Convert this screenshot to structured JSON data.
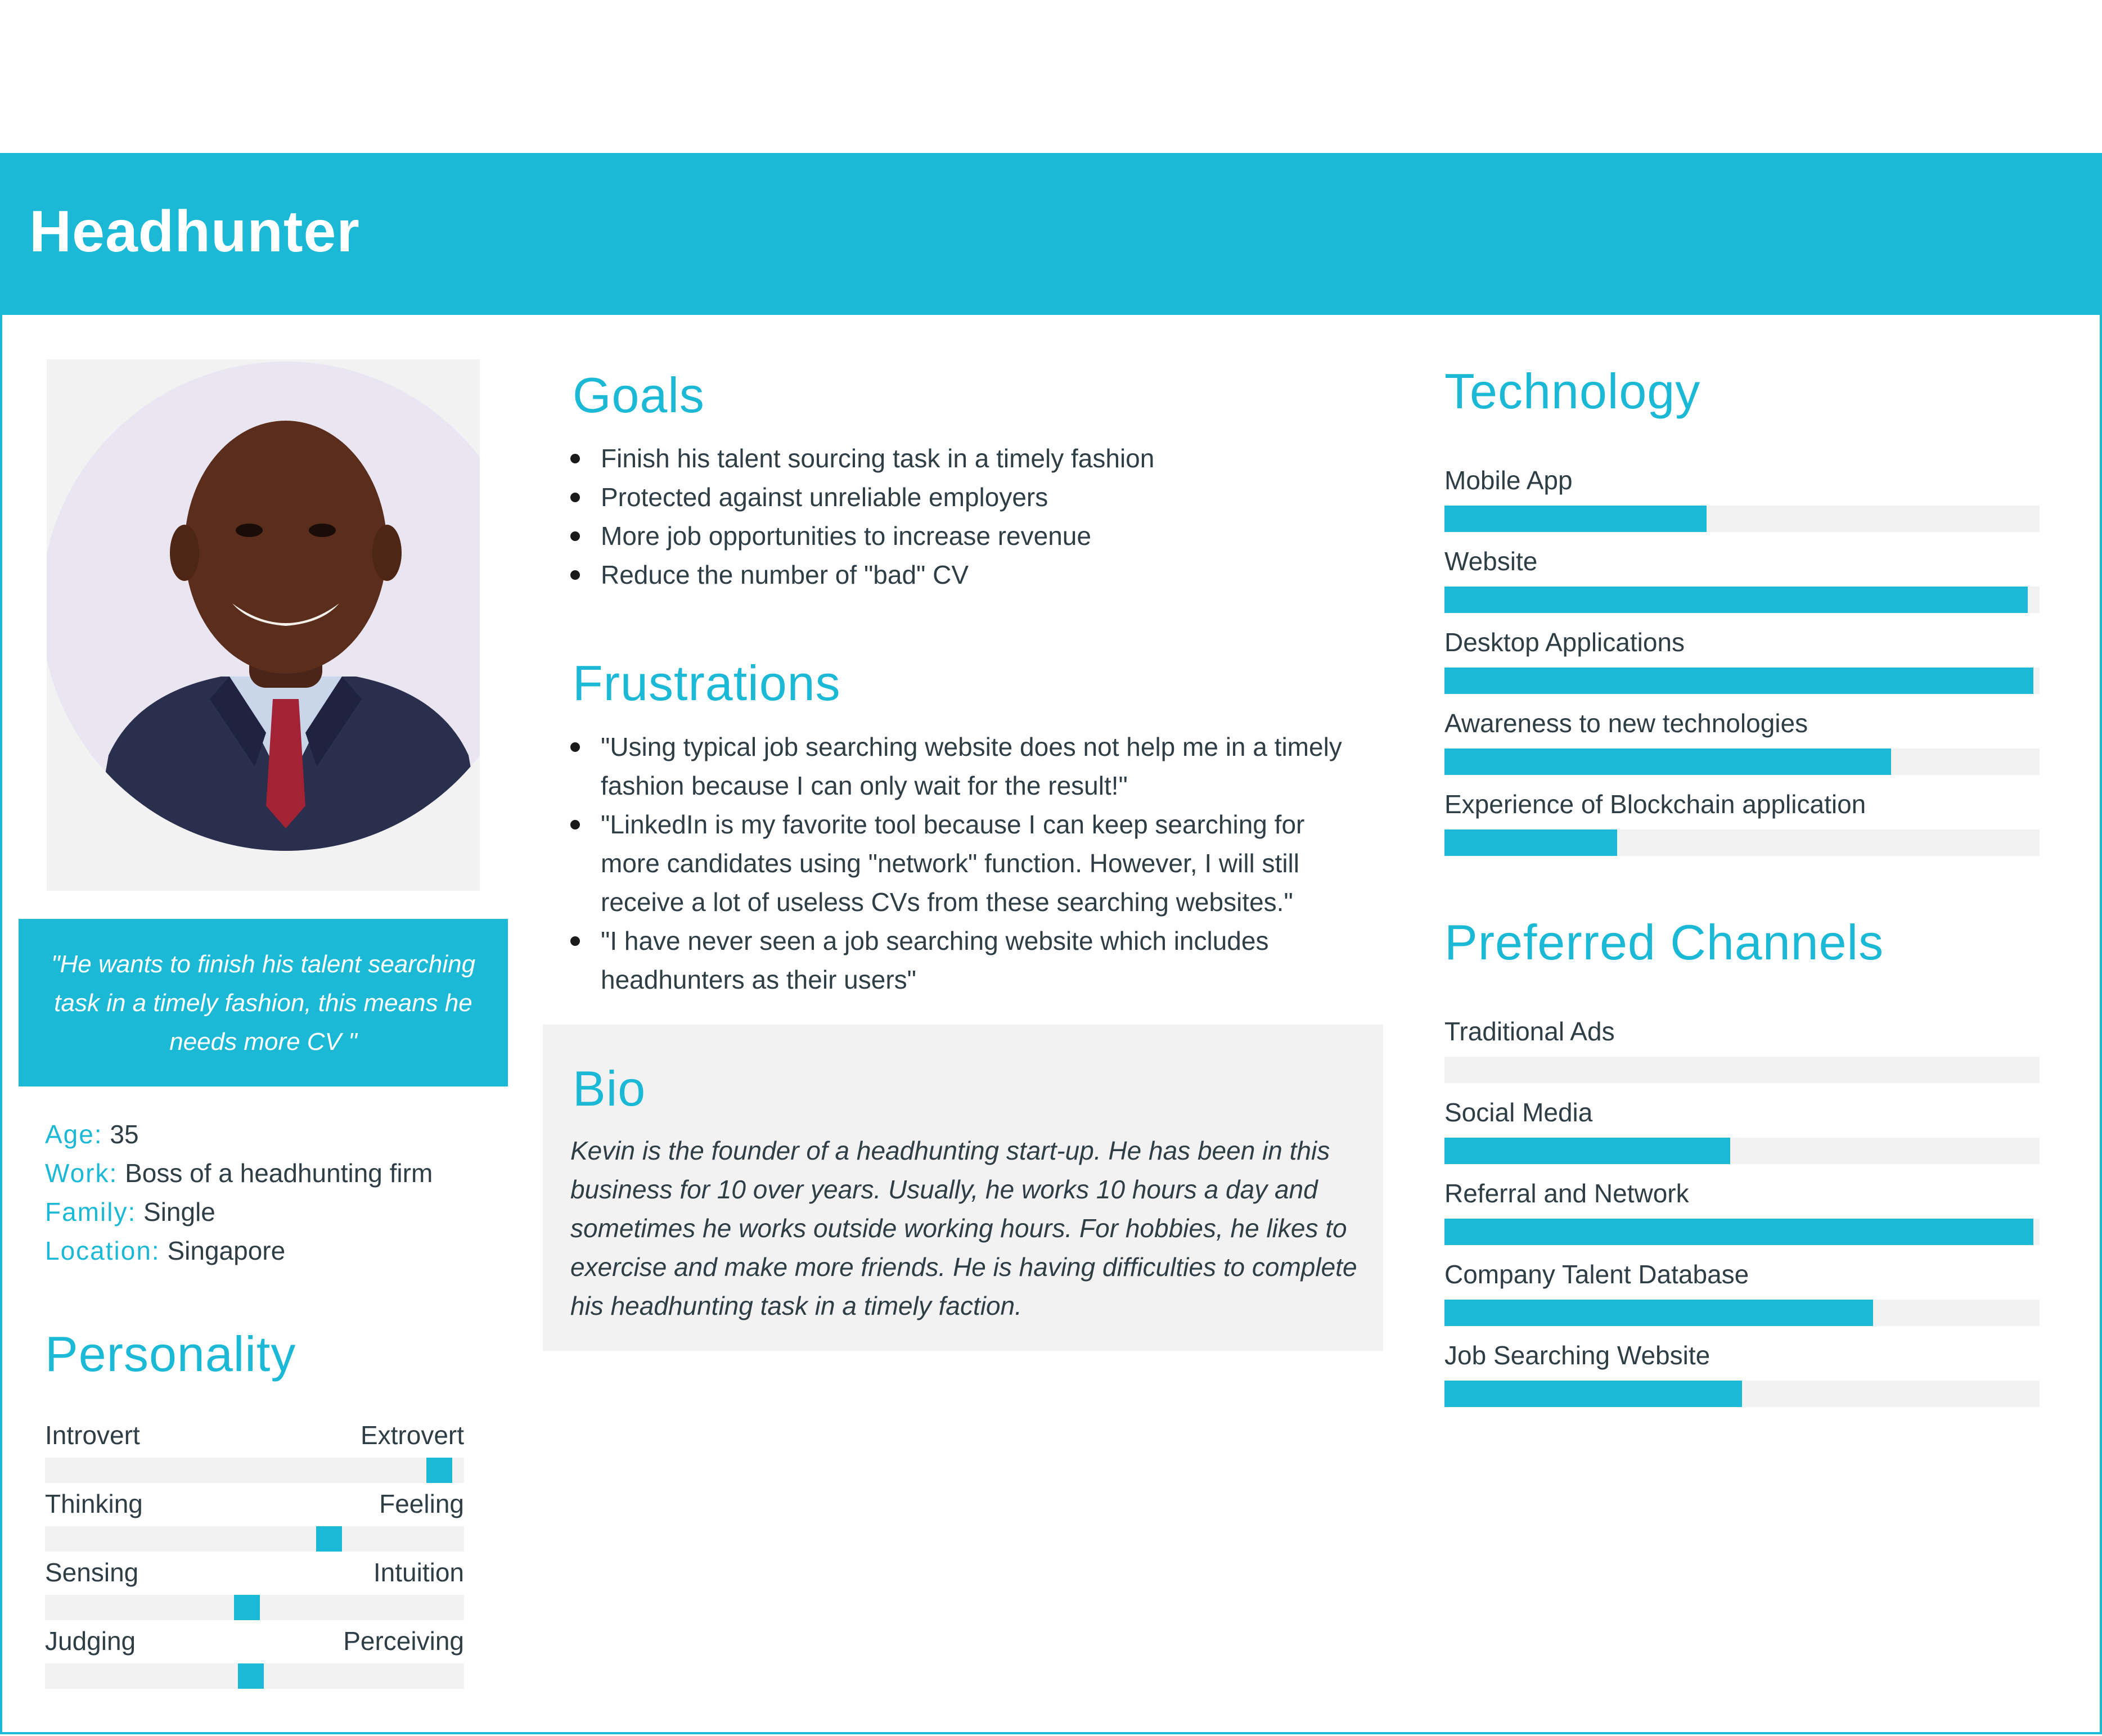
{
  "colors": {
    "accent": "#1bb9d6",
    "panel": "#f2f2f2",
    "text": "#2f3d45"
  },
  "header": {
    "title": "Headhunter"
  },
  "profile": {
    "quote": "\"He wants to finish his talent searching task in a timely fashion, this means he needs more CV \"",
    "facts": [
      {
        "label": "Age:",
        "value": "35"
      },
      {
        "label": "Work:",
        "value": "Boss of a headhunting firm"
      },
      {
        "label": "Family:",
        "value": "Single"
      },
      {
        "label": "Location:",
        "value": "Singapore"
      }
    ]
  },
  "personality": {
    "title": "Personality",
    "traits": [
      {
        "left": "Introvert",
        "right": "Extrovert",
        "position": 0.97
      },
      {
        "left": "Thinking",
        "right": "Feeling",
        "position": 0.69
      },
      {
        "left": "Sensing",
        "right": "Intuition",
        "position": 0.48
      },
      {
        "left": "Judging",
        "right": "Perceiving",
        "position": 0.49
      }
    ]
  },
  "goals": {
    "title": "Goals",
    "items": [
      "Finish his talent sourcing task in a timely fashion",
      "Protected against unreliable employers",
      "More job opportunities to increase revenue",
      "Reduce the number of \"bad\" CV"
    ]
  },
  "frustrations": {
    "title": "Frustrations",
    "items": [
      "\"Using typical job searching website does not help me in a timely fashion because I can only wait for the result!\"",
      "\"LinkedIn is my favorite tool because I can keep searching for more candidates using \"network\" function. However,  I will still receive a lot of useless CVs from these searching websites.\"",
      "\"I have never seen a job searching website which includes headhunters as their users\""
    ]
  },
  "bio": {
    "title": "Bio",
    "text": "Kevin is the founder of a headhunting start-up. He has been in this business for 10 over years. Usually, he works 10 hours a day and sometimes he works outside working hours. For hobbies, he likes to exercise and make more friends. He is having difficulties to complete his headhunting task in a timely faction."
  },
  "technology": {
    "title": "Technology",
    "items": [
      {
        "label": "Mobile App",
        "value": 0.44
      },
      {
        "label": "Website",
        "value": 0.98
      },
      {
        "label": "Desktop Applications",
        "value": 0.99
      },
      {
        "label": "Awareness to new technologies",
        "value": 0.75
      },
      {
        "label": "Experience of Blockchain application",
        "value": 0.29
      }
    ]
  },
  "channels": {
    "title": "Preferred Channels",
    "items": [
      {
        "label": "Traditional Ads",
        "value": 0
      },
      {
        "label": "Social Media",
        "value": 0.48
      },
      {
        "label": "Referral and Network",
        "value": 0.99
      },
      {
        "label": "Company Talent Database",
        "value": 0.72
      },
      {
        "label": "Job Searching Website",
        "value": 0.5
      }
    ]
  }
}
